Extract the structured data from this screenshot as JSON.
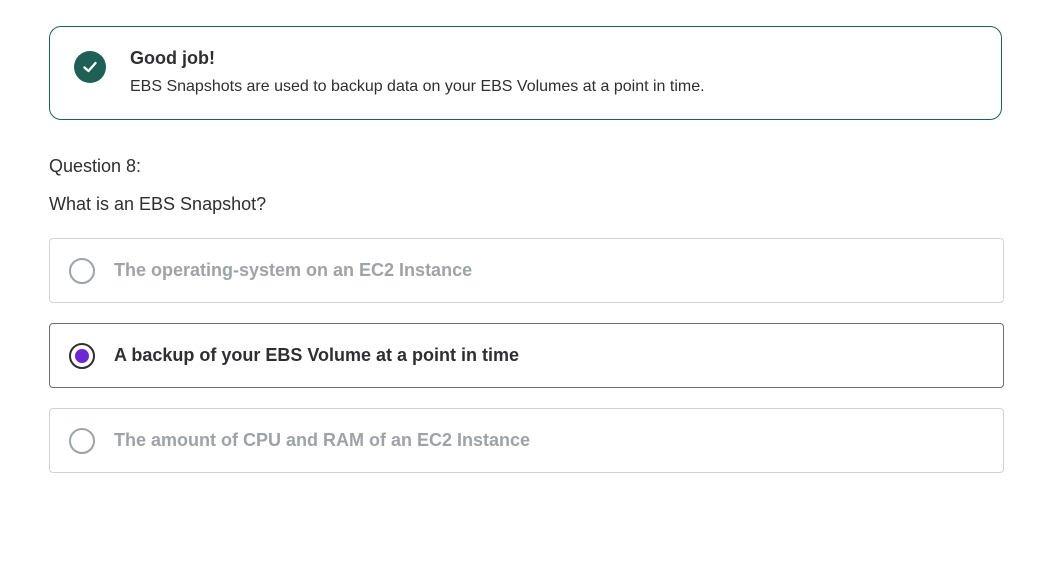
{
  "feedback": {
    "title": "Good job!",
    "message": "EBS Snapshots are used to backup data on your EBS Volumes at a point in time.",
    "icon": "check-icon",
    "color": "#1e6055"
  },
  "question": {
    "number_label": "Question 8:",
    "prompt": "What is an EBS Snapshot?"
  },
  "options": [
    {
      "label": "The operating-system on an EC2 Instance",
      "selected": false
    },
    {
      "label": "A backup of your EBS Volume at a point in time",
      "selected": true
    },
    {
      "label": "The amount of CPU and RAM of an EC2 Instance",
      "selected": false
    }
  ],
  "colors": {
    "accent": "#6d28d2",
    "text": "#2d2f31",
    "muted": "#9da3a7",
    "success": "#1e6055"
  }
}
